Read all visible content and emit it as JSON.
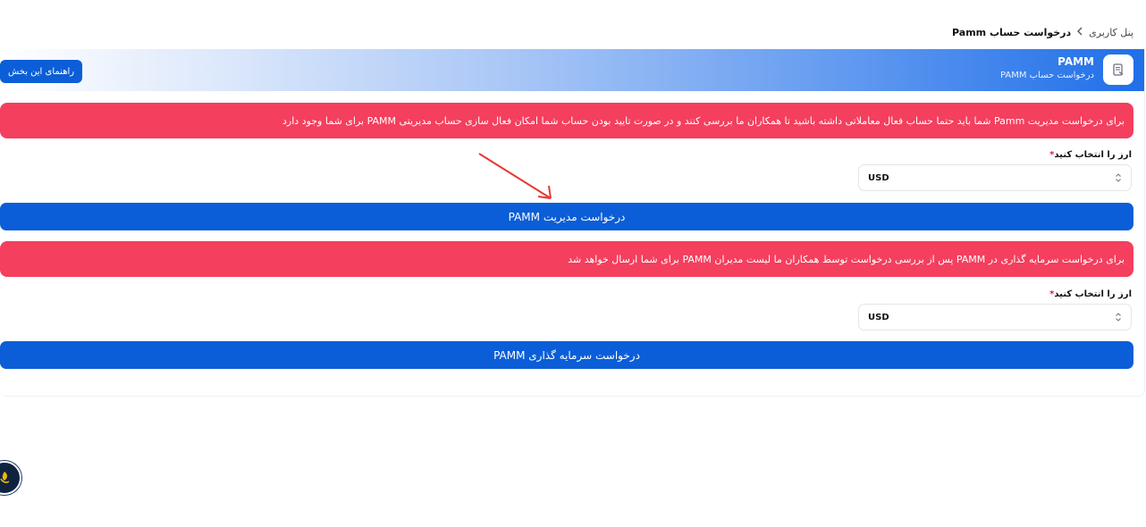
{
  "breadcrumb": {
    "parent": "پنل کاربری",
    "current": "درخواست حساب Pamm"
  },
  "banner": {
    "title": "PAMM",
    "subtitle": "درخواست حساب PAMM",
    "guide_button": "راهنمای این بخش"
  },
  "manager_section": {
    "alert": "برای درخواست مدیریت Pamm شما باید حتما حساب فعال معاملاتی داشته باشید تا همکاران ما بررسی کنند و در صورت تایید بودن حساب شما امکان فعال سازی حساب مدیریتی PAMM برای شما وجود دارد",
    "currency_label": "ارز را انتخاب کنید",
    "required_mark": "*",
    "currency_value": "USD",
    "button": "درخواست مدیریت PAMM"
  },
  "investment_section": {
    "alert": "برای درخواست سرمایه گذاری در PAMM پس از بررسی درخواست توسط همکاران ما لیست مدیران PAMM برای شما ارسال خواهد شد",
    "currency_label": "ارز را انتخاب کنید",
    "required_mark": "*",
    "currency_value": "USD",
    "button": "درخواست سرمایه گذاری PAMM"
  },
  "colors": {
    "primary": "#0b5ed7",
    "alert": "#f43f5e",
    "annotation_arrow": "#e53935"
  }
}
